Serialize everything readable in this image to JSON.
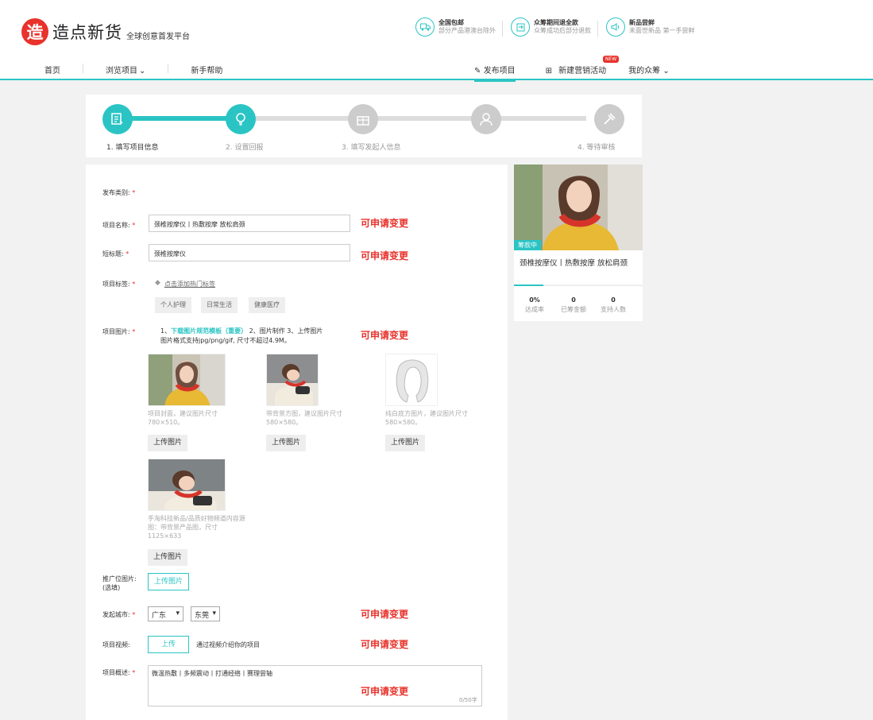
{
  "header": {
    "logo_char": "造",
    "brand": "造点新货",
    "tagline": "全球创意首发平台",
    "features": [
      {
        "icon": "truck-icon",
        "title": "全国包邮",
        "desc": "部分产品港澳台除外"
      },
      {
        "icon": "refund-icon",
        "title": "众筹期间退全款",
        "desc": "众筹成功后部分退款"
      },
      {
        "icon": "speaker-icon",
        "title": "新品尝鲜",
        "desc": "未面世新品 第一手尝鲜"
      }
    ]
  },
  "nav": {
    "home": "首页",
    "browse": "浏览项目",
    "help": "新手帮助",
    "publish": "发布项目",
    "promo": "新建营销活动",
    "promo_badge": "NEW",
    "mine": "我的众筹"
  },
  "steps": [
    {
      "label": "1. 填写项目信息",
      "done": true
    },
    {
      "label": "2. 设置回报",
      "done": true
    },
    {
      "label": "3. 填写发起人信息",
      "done": false
    },
    {
      "label": "",
      "done": false
    },
    {
      "label": "4. 等待审核",
      "done": false
    }
  ],
  "form": {
    "category_label": "发布类别:",
    "name_label": "项目名称:",
    "name_value": "颈椎按摩仪丨热敷按摩 放松肩颈",
    "subtitle_label": "短标题:",
    "subtitle_value": "颈椎按摩仪",
    "change_note": "可申请变更",
    "tags_label": "项目标签:",
    "tags_link": "点击添加热门标签",
    "tags": [
      "个人护理",
      "日常生活",
      "健康医疗"
    ],
    "images_label": "项目图片:",
    "images_instr_1a": "1、",
    "images_instr_link": "下载图片规范模板（重要）",
    "images_instr_1b": " 2、图片制作 3、上传图片",
    "images_instr_2": "图片格式支持jpg/png/gif, 尺寸不超过4.9M。",
    "images": [
      {
        "caption": "项目封面，建议图片尺寸",
        "size": "780×510。"
      },
      {
        "caption": "带背景方图，建议图片尺寸",
        "size": "580×580。"
      },
      {
        "caption": "纯白底方图片，建议图片尺寸",
        "size": "580×580。"
      },
      {
        "caption": "手淘科技新品/品质好物频道内容源图：带背景产品图，尺寸",
        "size": "1125×633"
      }
    ],
    "upload_label": "上传图片",
    "promo_label": "推广位图片:",
    "promo_sub": "(选填)",
    "city_label": "发起城市:",
    "province": "广东",
    "city": "东莞",
    "video_label": "项目视频:",
    "video_button": "上传",
    "video_hint": "通过视频介绍你的项目",
    "summary_label": "项目概述:",
    "summary_value": "微温热敷丨多频震动丨打通经络丨赛理尝轴",
    "summary_counter": "0/50字"
  },
  "preview": {
    "badge": "筹款中",
    "title": "颈椎按摩仪丨热敷按摩 放松肩颈",
    "progress": 0.23,
    "stats": [
      {
        "value": "0%",
        "label": "达成率"
      },
      {
        "value": "0",
        "label": "已筹金额"
      },
      {
        "value": "0",
        "label": "支持人数"
      }
    ]
  },
  "colors": {
    "accent": "#2bc4c4",
    "brand": "#e8322b"
  }
}
